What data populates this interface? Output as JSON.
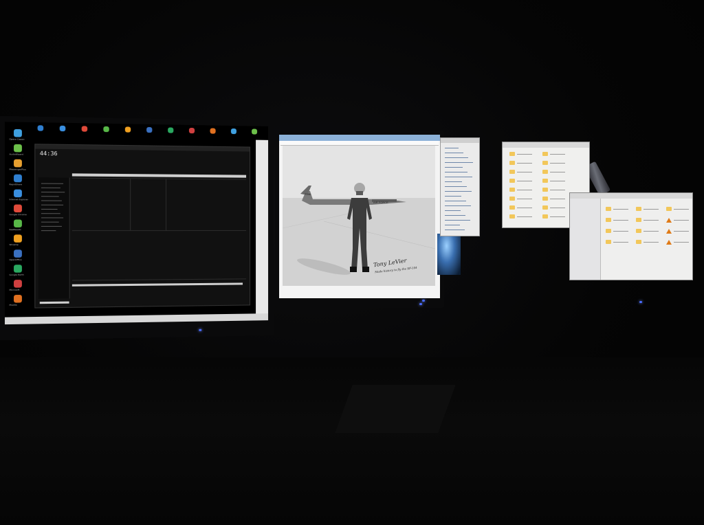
{
  "scene": {
    "desktop_icons": [
      "Opera Classic",
      "AudioWizard",
      "MessengerPlus",
      "RapidShare",
      "Internet Explorer",
      "Google Chrome",
      "KeePassXC",
      "Winamp",
      "OpenOffice",
      "Google Earth",
      "Microsoft",
      "Mozilla"
    ],
    "player": {
      "clock": "44:36"
    },
    "photo": {
      "plane_marking": "AIR FORCE",
      "plane_number": "7786",
      "signature": "Tony LeVier",
      "inscription": "Made history to fly the XF-104"
    },
    "colors": {
      "background": "#040404",
      "led": "#4a6cff",
      "folder": "#f2c75a",
      "cone": "#e07a16",
      "browser_tab": "#8cb1d8"
    }
  }
}
